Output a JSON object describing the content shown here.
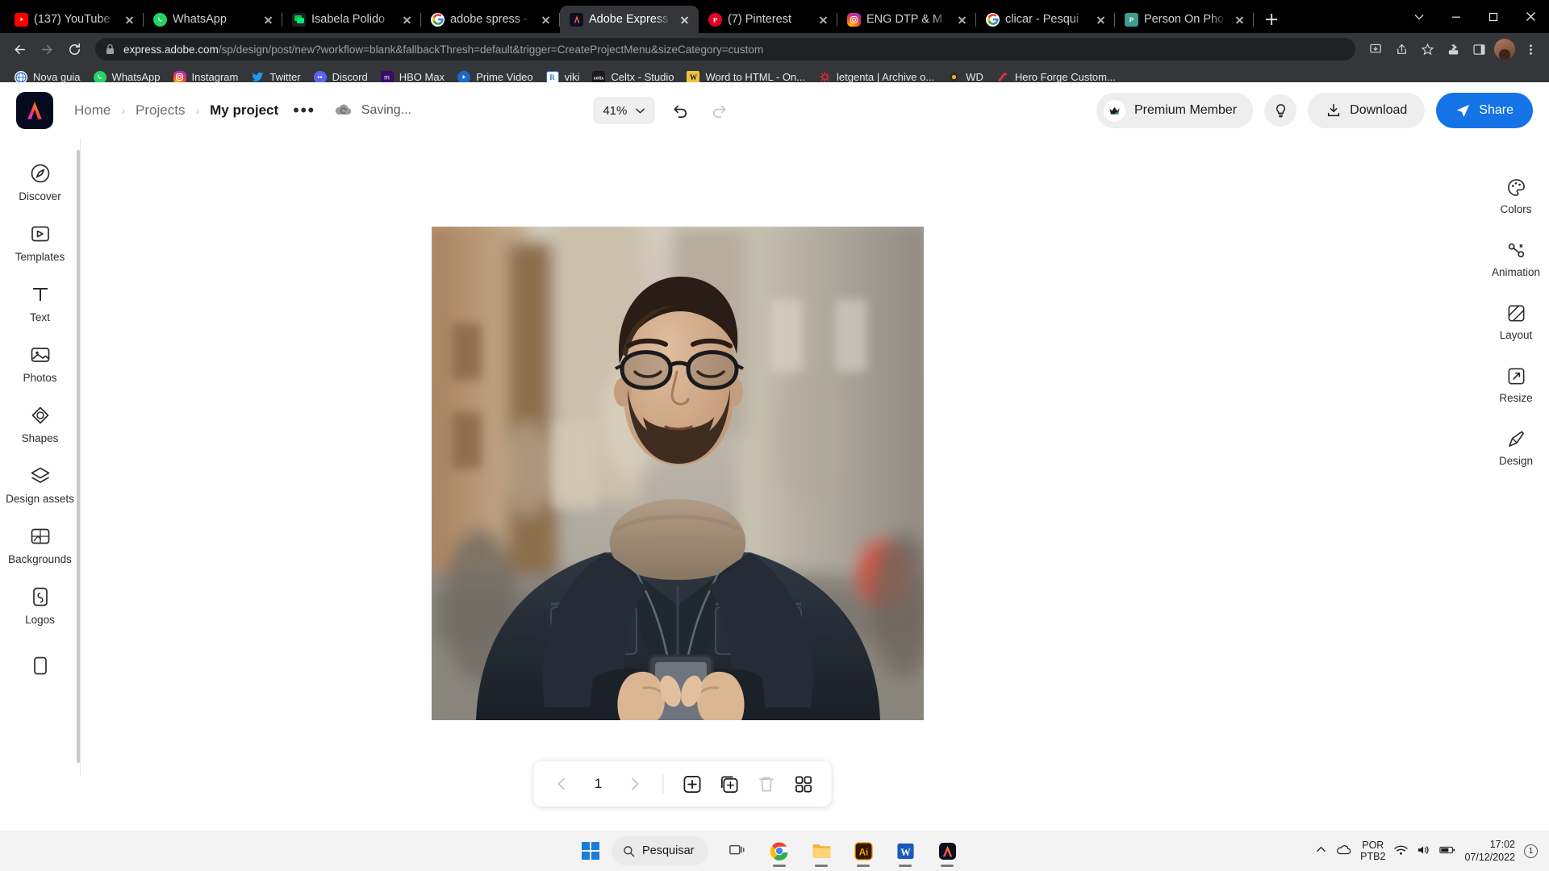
{
  "browser": {
    "tabs": [
      {
        "title": "(137) YouTube",
        "icon": "youtube-icon",
        "active": false
      },
      {
        "title": "WhatsApp",
        "icon": "whatsapp-icon",
        "active": false
      },
      {
        "title": "Isabela Polido",
        "icon": "messages-icon",
        "active": false
      },
      {
        "title": "adobe spress -",
        "icon": "google-icon",
        "active": false
      },
      {
        "title": "Adobe Express",
        "icon": "adobe-express-icon",
        "active": true
      },
      {
        "title": "(7) Pinterest",
        "icon": "pinterest-icon",
        "active": false
      },
      {
        "title": "ENG DTP & M",
        "icon": "instagram-icon",
        "active": false
      },
      {
        "title": "clicar - Pesqui",
        "icon": "google-icon",
        "active": false
      },
      {
        "title": "Person On Pho",
        "icon": "powerpoint-icon",
        "active": false
      }
    ],
    "new_tab_label": "+",
    "url_domain": "express.adobe.com",
    "url_path": "/sp/design/post/new?workflow=blank&fallbackThresh=default&trigger=CreateProjectMenu&sizeCategory=custom",
    "bookmarks": [
      {
        "label": "Nova guia",
        "icon": "globe-icon"
      },
      {
        "label": "WhatsApp",
        "icon": "whatsapp-icon"
      },
      {
        "label": "Instagram",
        "icon": "instagram-icon"
      },
      {
        "label": "Twitter",
        "icon": "twitter-icon"
      },
      {
        "label": "Discord",
        "icon": "discord-icon"
      },
      {
        "label": "HBO Max",
        "icon": "hbomax-icon"
      },
      {
        "label": "Prime Video",
        "icon": "primevideo-icon"
      },
      {
        "label": "viki",
        "icon": "viki-icon"
      },
      {
        "label": "Celtx - Studio",
        "icon": "celtx-icon"
      },
      {
        "label": "Word to HTML - On...",
        "icon": "word-icon"
      },
      {
        "label": "letgenta | Archive o...",
        "icon": "archive-icon"
      },
      {
        "label": "WD",
        "icon": "wd-icon"
      },
      {
        "label": "Hero Forge Custom...",
        "icon": "heroforge-icon"
      }
    ]
  },
  "app": {
    "logo": "adobe-express-logo",
    "breadcrumb": {
      "home": "Home",
      "projects": "Projects",
      "current": "My project"
    },
    "more_label": "•••",
    "saving_label": "Saving...",
    "zoom_level": "41%",
    "premium_label": "Premium Member",
    "download_label": "Download",
    "share_label": "Share",
    "left_rail": [
      {
        "label": "Discover",
        "icon": "discover-icon"
      },
      {
        "label": "Templates",
        "icon": "templates-icon"
      },
      {
        "label": "Text",
        "icon": "text-icon"
      },
      {
        "label": "Photos",
        "icon": "photos-icon"
      },
      {
        "label": "Shapes",
        "icon": "shapes-icon"
      },
      {
        "label": "Design assets",
        "icon": "design-assets-icon"
      },
      {
        "label": "Backgrounds",
        "icon": "backgrounds-icon"
      },
      {
        "label": "Logos",
        "icon": "logos-icon"
      }
    ],
    "right_rail": [
      {
        "label": "Colors",
        "icon": "colors-icon"
      },
      {
        "label": "Animation",
        "icon": "animation-icon"
      },
      {
        "label": "Layout",
        "icon": "layout-icon"
      },
      {
        "label": "Resize",
        "icon": "resize-icon"
      },
      {
        "label": "Design",
        "icon": "design-icon"
      }
    ],
    "page_controls": {
      "prev": "prev-page-icon",
      "page_number": "1",
      "next": "next-page-icon",
      "add_page": "add-page-icon",
      "duplicate_page": "duplicate-page-icon",
      "delete_page": "delete-page-icon",
      "grid_view": "grid-view-icon"
    },
    "canvas_image_alt": "Man with glasses and beard in dark jacket looking at smartphone on a city street"
  },
  "taskbar": {
    "start_label": "start-icon",
    "search_placeholder": "Pesquisar",
    "apps": [
      "task-view-icon",
      "chrome-icon",
      "file-explorer-icon",
      "illustrator-icon",
      "word-icon",
      "adobe-express-icon"
    ],
    "lang_line1": "POR",
    "lang_line2": "PTB2",
    "time": "17:02",
    "date": "07/12/2022",
    "notification_count": "1"
  },
  "colors": {
    "share_blue": "#1473e6",
    "tab_active_bg": "#35363a",
    "chrome_bg": "#35363a",
    "omnibox_bg": "#202124"
  }
}
